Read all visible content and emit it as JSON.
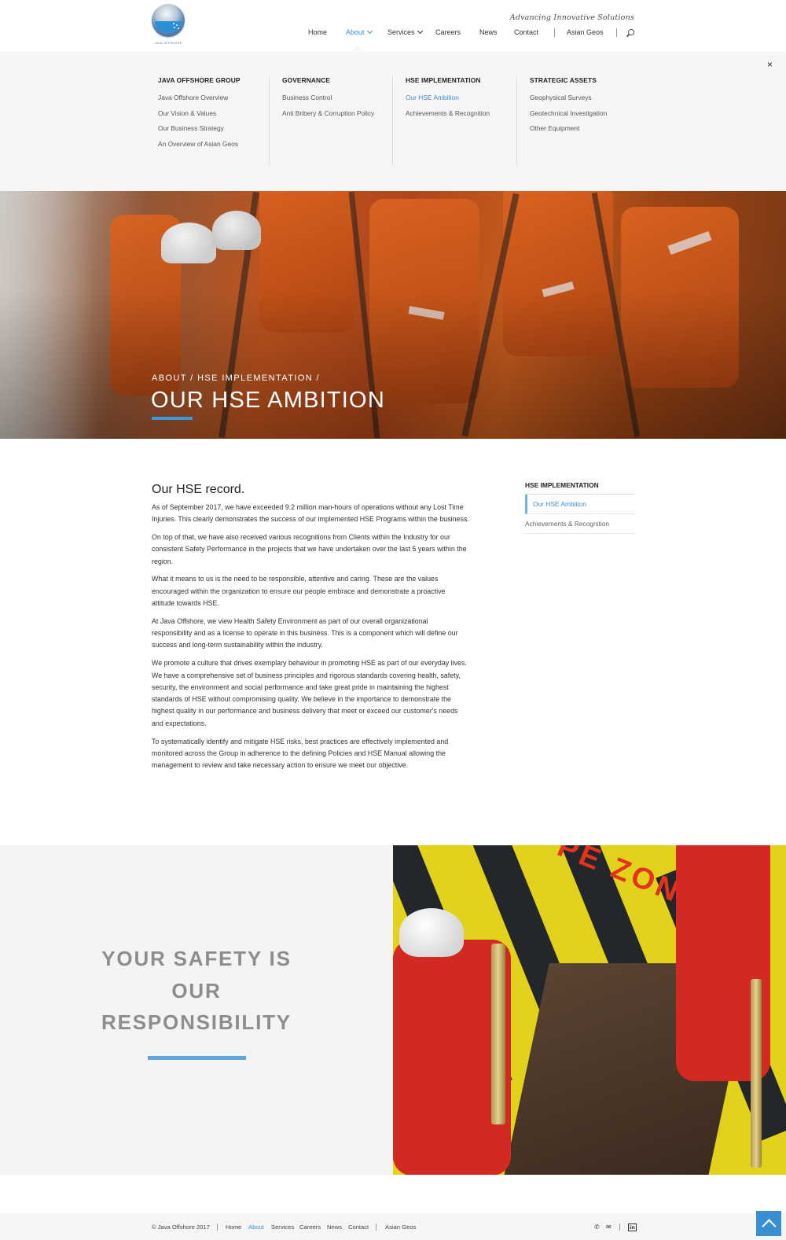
{
  "header": {
    "logo_text": "JAVA OFFSHORE",
    "tagline": "Advancing Innovative Solutions",
    "nav": [
      {
        "label": "Home",
        "active": false
      },
      {
        "label": "About",
        "active": true
      },
      {
        "label": "Services",
        "active": false
      },
      {
        "label": "Careers",
        "active": false
      },
      {
        "label": "News",
        "active": false
      },
      {
        "label": "Contact",
        "active": false
      },
      {
        "label": "Asian Geos",
        "active": false
      }
    ],
    "icons": {
      "search": "search-icon",
      "chevron": "chevron-down-icon"
    }
  },
  "mega_menu": {
    "close": "×",
    "columns": [
      {
        "heading": "JAVA OFFSHORE GROUP",
        "links": [
          "Java Offshore Overview",
          "Our Vision & Values",
          "Our Business Strategy",
          "An Overview of Asian Geos"
        ]
      },
      {
        "heading": "GOVERNANCE",
        "links": [
          "Business Control",
          "Anti Bribery & Corruption Policy"
        ]
      },
      {
        "heading": "HSE IMPLEMENTATION",
        "links": [
          "Our HSE Ambition",
          "Achievements & Recognition"
        ],
        "selected": 0
      },
      {
        "heading": "STRATEGIC ASSETS",
        "links": [
          "Geophysical Surveys",
          "Geotechnical Investigation",
          "Other Equipment"
        ]
      }
    ]
  },
  "hero": {
    "breadcrumb": "ABOUT / HSE IMPLEMENTATION /",
    "title": "OUR HSE AMBITION",
    "accent": "#3a9ad9"
  },
  "main": {
    "heading": "Our HSE record.",
    "paragraphs": [
      "As of September 2017, we have exceeded 9.2 million man-hours of operations without any Lost Time Injuries. This clearly demonstrates the success of our implemented HSE Programs within the business.",
      "On top of that, we have also received various recognitions from Clients within the Industry for our consistent Safety Performance in the projects that we have undertaken over the last 5 years within the region.",
      "What it means to us is the need to be responsible, attentive and caring. These are the values encouraged within the organization to ensure our people embrace and demonstrate a proactive attitude towards HSE.",
      "At Java Offshore, we view Health Safety Environment as part of our overall organizational responsibility and as a license to operate in this business. This is a component which will define our success and long-term sustainability within the industry.",
      "We promote a culture that drives exemplary behaviour in promoting HSE as part of our everyday lives. We have a comprehensive set of business principles and rigorous standards covering health, safety, security, the environment and social performance and take great pride in maintaining the highest standards of HSE without compromising quality. We believe in the importance to demonstrate the highest quality in our performance and business delivery that meet or exceed our customer's needs and expectations.",
      "To systematically identify and mitigate HSE risks, best practices are effectively implemented and monitored across the Group in adherence to the defining Policies and HSE Manual allowing the management to review and take necessary action to ensure we meet our objective."
    ]
  },
  "sidebar": {
    "heading": "HSE IMPLEMENTATION",
    "items": [
      {
        "label": "Our HSE Ambition",
        "selected": true
      },
      {
        "label": "Achievements & Recognition",
        "selected": false
      }
    ]
  },
  "band": {
    "title_lines": [
      "YOUR SAFETY IS",
      "OUR",
      "RESPONSIBILITY"
    ],
    "image_text": "PE ZON",
    "accent": "#5aa8e2"
  },
  "footer": {
    "copyright": "© Java Offshore 2017",
    "links": [
      "Home",
      "About",
      "Services",
      "Careers",
      "News",
      "Contact",
      "Asian Geos"
    ],
    "active_link": "About",
    "icons": [
      "phone-icon",
      "mail-icon",
      "linkedin-icon"
    ],
    "icon_glyphs": {
      "phone": "✆",
      "mail": "✉",
      "linkedin": "in"
    },
    "back_to_top": "back-to-top-icon"
  }
}
